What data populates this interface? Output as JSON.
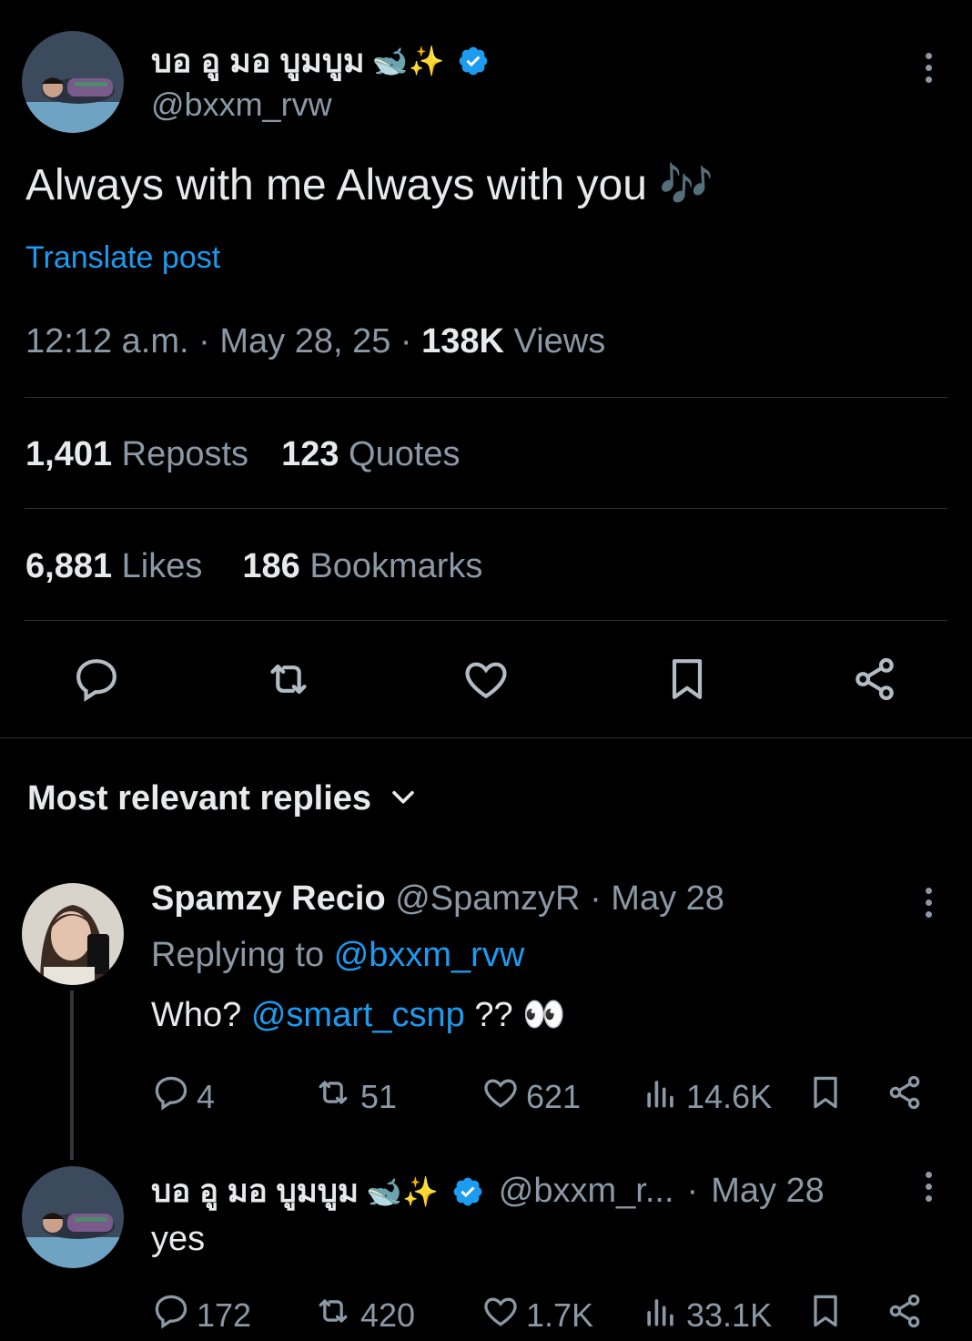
{
  "post": {
    "author_name": "บอ อู มอ บูมบูม",
    "author_emoji": "🐋✨",
    "author_handle": "@bxxm_rvw",
    "text": "Always with me Always with you",
    "text_emoji": "🎶",
    "translate_label": "Translate post",
    "time": "12:12 a.m.",
    "date": "May 28, 25",
    "views_count": "138K",
    "views_label": "Views",
    "reposts_count": "1,401",
    "reposts_label": "Reposts",
    "quotes_count": "123",
    "quotes_label": "Quotes",
    "likes_count": "6,881",
    "likes_label": "Likes",
    "bookmarks_count": "186",
    "bookmarks_label": "Bookmarks"
  },
  "replies_header": {
    "label": "Most relevant replies"
  },
  "replies": [
    {
      "author_name": "Spamzy Recio",
      "author_handle": "@SpamzyR",
      "date": "May 28",
      "replying_prefix": "Replying to",
      "replying_handle": "@bxxm_rvw",
      "text_before": "Who?",
      "mention": "@smart_csnp",
      "text_after": "??",
      "text_emoji": "👀",
      "replies": "4",
      "reposts": "51",
      "likes": "621",
      "views": "14.6K"
    },
    {
      "author_name": "บอ อู มอ บูมบูม",
      "author_emoji": "🐋✨",
      "author_handle": "@bxxm_r...",
      "date": "May 28",
      "text": "yes",
      "replies": "172",
      "reposts": "420",
      "likes": "1.7K",
      "views": "33.1K"
    }
  ],
  "colors": {
    "background": "#000000",
    "text": "#e7e9ea",
    "secondary": "#8b98a5",
    "link": "#1d9bf0",
    "verified": "#1d9bf0",
    "divider": "#2f3336"
  },
  "icons": [
    "verified-badge-icon",
    "more-icon",
    "reply-icon",
    "repost-icon",
    "like-icon",
    "bookmark-icon",
    "share-icon",
    "views-icon",
    "chevron-down-icon"
  ]
}
